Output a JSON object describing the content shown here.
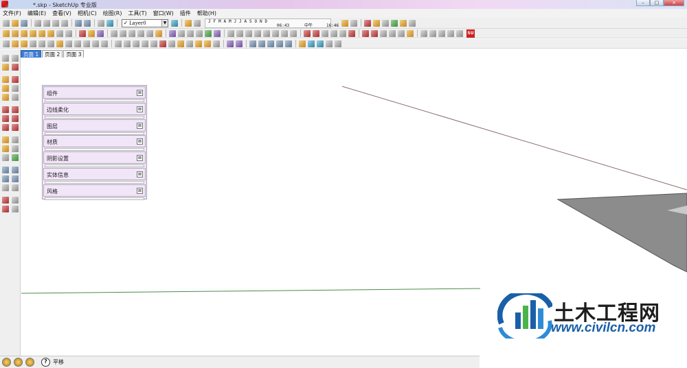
{
  "window": {
    "title": "*.skp - SketchUp 专业版",
    "buttons": [
      "–",
      "□",
      "×"
    ]
  },
  "menu": [
    "文件(F)",
    "编辑(E)",
    "查看(V)",
    "相机(C)",
    "绘图(R)",
    "工具(T)",
    "窗口(W)",
    "插件",
    "帮助(H)"
  ],
  "layer_toolbar": {
    "current_layer": "Layer0",
    "check": "✓"
  },
  "shadow_toolbar": {
    "months": [
      "J",
      "F",
      "M",
      "A",
      "M",
      "J",
      "J",
      "A",
      "S",
      "O",
      "N",
      "D"
    ],
    "start_time": "06:43",
    "noon_label": "中午",
    "end_time": "16:46"
  },
  "page_tabs": [
    {
      "label": "页面 1",
      "active": true
    },
    {
      "label": "页面 2",
      "active": false
    },
    {
      "label": "页面 3",
      "active": false
    }
  ],
  "tray": {
    "panels": [
      "组件",
      "边线柔化",
      "图层",
      "材质",
      "阴影设置",
      "实体信息",
      "风格"
    ],
    "close_glyph": "⊠"
  },
  "status": {
    "help_glyph": "?",
    "message": "平移"
  },
  "watermark": {
    "brand": "土木工程网",
    "url": "www.civilcn.com"
  },
  "colors": {
    "accent_tab": "#3b7bd4",
    "tray_header": "#f1e5f8",
    "ground_line": "#4a8a4a",
    "model_edge": "#8a6a6a",
    "model_face": "#8c8c8c",
    "watermark_blue": "#1a5fa8"
  }
}
